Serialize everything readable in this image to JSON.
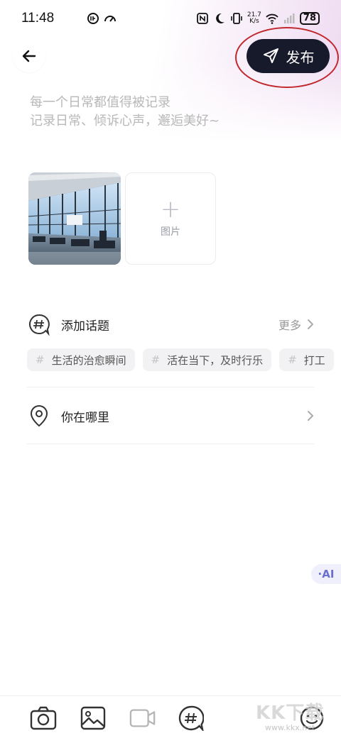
{
  "status_bar": {
    "time": "11:48",
    "net_speed_value": "21.7",
    "net_speed_unit": "K/s",
    "battery": "78"
  },
  "header": {
    "back_icon": "arrow-left-icon",
    "publish_label": "发布",
    "publish_icon": "send-icon"
  },
  "editor": {
    "placeholder_line1": "每一个日常都值得被记录",
    "placeholder_line2": "记录日常、倾诉心声，邂逅美好~"
  },
  "media": {
    "add_label": "图片"
  },
  "topics": {
    "title": "添加话题",
    "more_label": "更多",
    "chips": [
      {
        "label": "生活的治愈瞬间"
      },
      {
        "label": "活在当下，及时行乐"
      },
      {
        "label": "打工"
      }
    ]
  },
  "location": {
    "title": "你在哪里"
  },
  "ai_badge": "·AI",
  "toolbar": {
    "icons": [
      "camera-icon",
      "image-icon",
      "video-icon",
      "hashtag-icon",
      "emoji-icon"
    ]
  },
  "watermark": {
    "big": "KK下载",
    "small": "www.kkx.net"
  },
  "colors": {
    "publish_bg": "#171a2b",
    "annotation_ring": "#c0282d",
    "ai_accent": "#6a6fd0"
  }
}
